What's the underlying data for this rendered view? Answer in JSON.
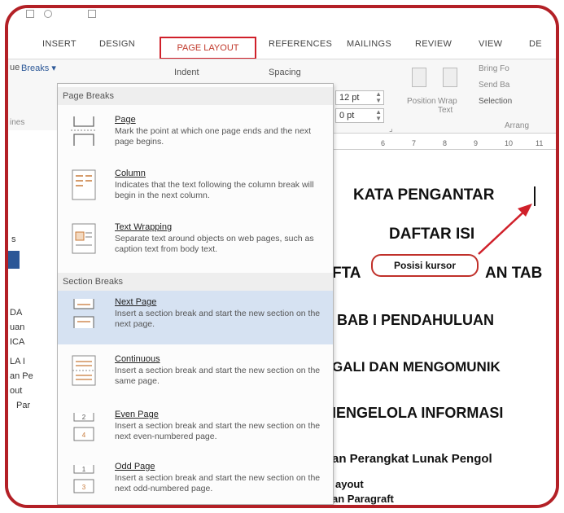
{
  "ribbon": {
    "tabs": [
      "INSERT",
      "DESIGN",
      "PAGE LAYOUT",
      "REFERENCES",
      "MAILINGS",
      "REVIEW",
      "VIEW",
      "DE"
    ],
    "active_tab": "PAGE LAYOUT",
    "breaks_label": "Breaks",
    "indent_label": "Indent",
    "spacing_label": "Spacing",
    "spacing_before": "12 pt",
    "spacing_after": "0 pt",
    "position_label": "Position",
    "wrap_text_label": "Wrap Text",
    "bring_forward_label": "Bring Fo",
    "send_backward_label": "Send Ba",
    "selection_label": "Selection",
    "arrange_label": "Arrang",
    "left_clip_label": "ue",
    "left_clip_label2": "ines"
  },
  "ruler": [
    "6",
    "7",
    "8",
    "9",
    "10",
    "11"
  ],
  "breaks_menu": {
    "page_breaks_header": "Page Breaks",
    "section_breaks_header": "Section Breaks",
    "items": [
      {
        "title": "Page",
        "desc": "Mark the point at which one page ends and the next page begins."
      },
      {
        "title": "Column",
        "desc": "Indicates that the text following the column break will begin in the next column."
      },
      {
        "title": "Text Wrapping",
        "desc": "Separate text around objects on web pages, such as caption text from body text."
      },
      {
        "title": "Next Page",
        "desc": "Insert a section break and start the new section on the next page."
      },
      {
        "title": "Continuous",
        "desc": "Insert a section break and start the new section on the same page."
      },
      {
        "title": "Even Page",
        "desc": "Insert a section break and start the new section on the next even-numbered page."
      },
      {
        "title": "Odd Page",
        "desc": "Insert a section break and start the new section on the next odd-numbered page."
      }
    ]
  },
  "nav_pane": [
    "s",
    "DA",
    "uan",
    "ICA",
    "LA I",
    "an Pe",
    "out",
    "Par"
  ],
  "document": {
    "lines": [
      "KATA PENGANTAR",
      "DAFTAR ISI",
      "FTA",
      "AN TAB",
      "BAB I   PENDAHULUAN",
      "GALI DAN MENGOMUNIK",
      "IENGELOLA INFORMASI",
      "an Perangkat Lunak Pengol",
      "ayout",
      "an Paragraft"
    ]
  },
  "annotation": {
    "label": "Posisi kursor"
  },
  "colors": {
    "highlight_border": "#d0202a",
    "frame": "#b32026",
    "menu_hover": "#d6e2f2",
    "accent": "#2b5797"
  }
}
